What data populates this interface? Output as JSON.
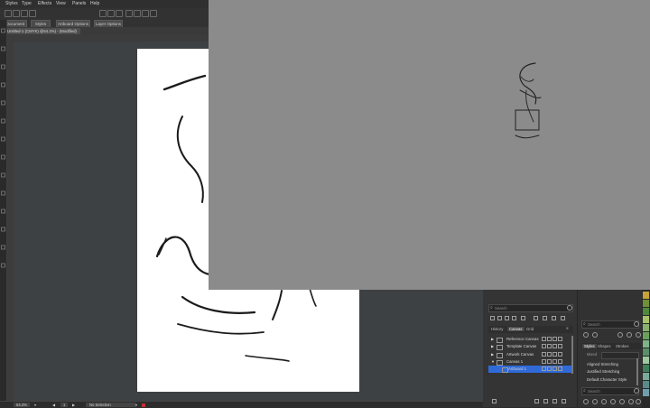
{
  "menubar": {
    "items": [
      "Styles",
      "Type",
      "Effects",
      "View",
      "Panels",
      "Help"
    ]
  },
  "controlbar": {
    "buttons": [
      "Document",
      "Styles",
      "Artboard Options",
      "Layer Options"
    ]
  },
  "document_tab": {
    "title": "Untitled-1 (CMYK) @64.2%) - (Modified)"
  },
  "status": {
    "zoom": "64.2%",
    "artboard": "1",
    "selection": "No Selection"
  },
  "canvases_panel": {
    "search_placeholder": "Search",
    "tabs": [
      "History",
      "Canvas",
      "Grid"
    ],
    "active_tab": "Canvas",
    "rows": [
      {
        "label": "Reference Canvas",
        "expanded": false,
        "selected": false
      },
      {
        "label": "Template Canvas",
        "expanded": false,
        "selected": false
      },
      {
        "label": "Artwork Canvas",
        "expanded": false,
        "selected": false
      },
      {
        "label": "Canvas 1",
        "expanded": true,
        "selected": false
      },
      {
        "label": "Artboard 1",
        "expanded": false,
        "selected": true
      }
    ]
  },
  "styles_panel": {
    "search_placeholder": "Search",
    "tabs": [
      "Styles",
      "Shapes",
      "Strokes"
    ],
    "dropdown_label": "Mixed",
    "items": [
      "Aligned Stretching",
      "Justified Stretching",
      "Default Character Style"
    ],
    "bottom_search_placeholder": "Search"
  },
  "colors": {
    "accent": "#2f6ad8",
    "overlay": "#8b8b8b",
    "swatches": [
      "#c8a23a",
      "#6f8f3a",
      "#4f8a3f",
      "#a8c46a",
      "#88b070",
      "#6aa05a",
      "#7fb38a",
      "#5a8f6a",
      "#9fc8a0",
      "#3f7f5a",
      "#7aaa9a",
      "#5c8a8a",
      "#6fa0b0"
    ]
  }
}
